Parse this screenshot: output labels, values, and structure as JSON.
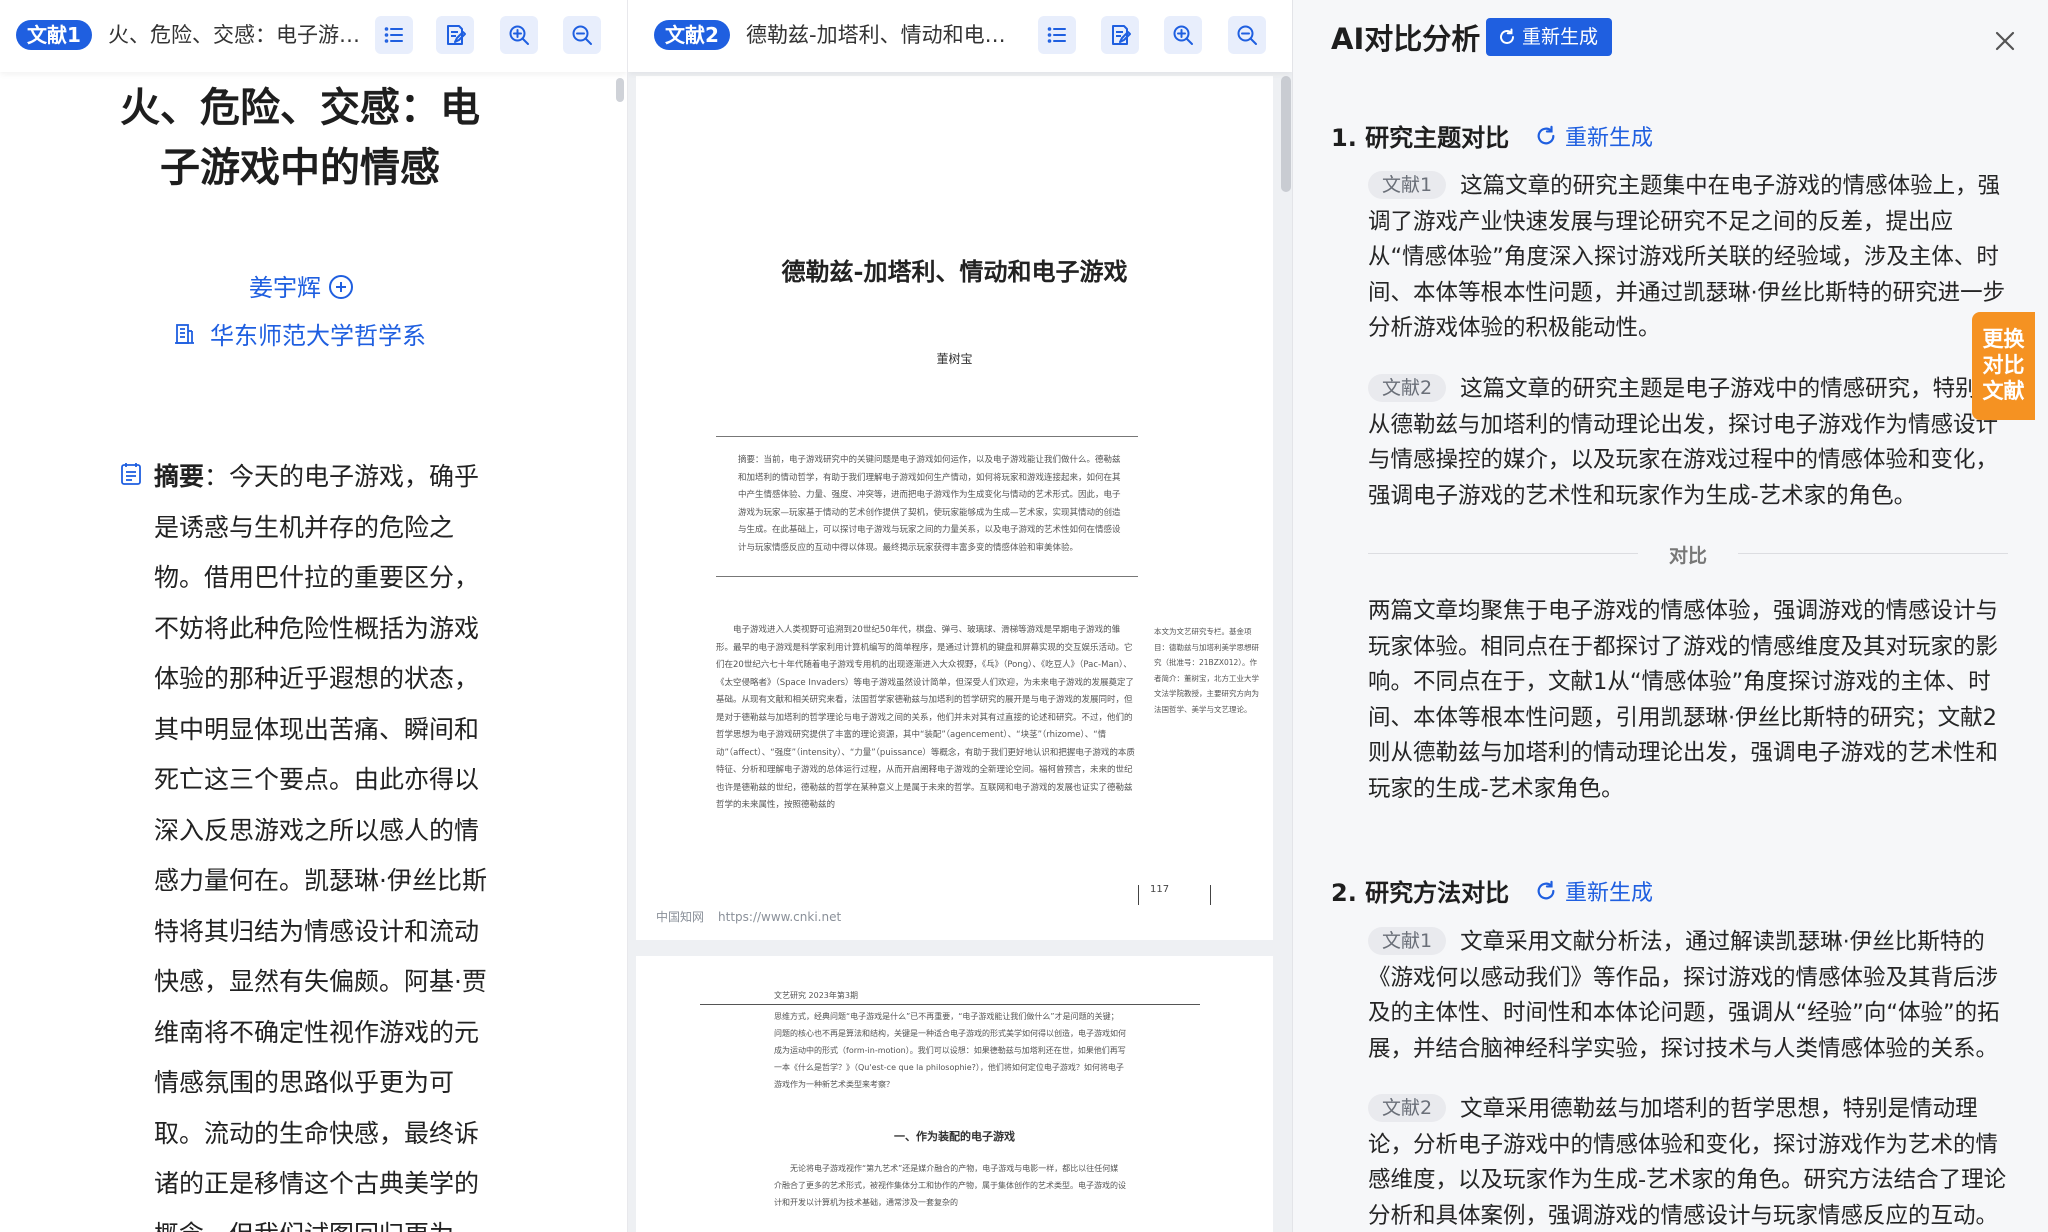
{
  "doc1": {
    "tag": "文献1",
    "toolbar_title": "火、危险、交感：电子游戏中的情感",
    "title": "火、危险、交感：电子游戏中的情感",
    "author": "姜宇辉",
    "affiliation": "华东师范大学哲学系",
    "abstract_label": "摘要",
    "abstract_text": "：今天的电子游戏，确乎是诱惑与生机并存的危险之物。借用巴什拉的重要区分，不妨将此种危险性概括为游戏体验的那种近乎遐想的状态，其中明显体现出苦痛、瞬间和死亡这三个要点。由此亦得以深入反思游戏之所以感人的情感力量何在。凯瑟琳·伊丝比斯特将其归结为情感设计和流动快感，显然有失偏颇。阿基·贾维南将不确定性视作游戏的元情感氛围的思路似乎更为可取。流动的生命快感，最终诉诸的正是移情这个古典美学的概念，但我们试图回归更为"
  },
  "doc2": {
    "tag": "文献2",
    "toolbar_title": "德勒兹-加塔利、情动和电子游戏",
    "title": "德勒兹-加塔利、情动和电子游戏",
    "author": "董树宝",
    "abstract": "摘要：当前，电子游戏研究中的关键问题是电子游戏如何运作，以及电子游戏能让我们做什么。德勒兹和加塔利的情动哲学，有助于我们理解电子游戏如何生产情动，如何将玩家和游戏连接起来，如何在其中产生情感体验、力量、强度、冲突等，进而把电子游戏作为生成变化与情动的艺术形式。因此，电子游戏为玩家—玩家基于情动的艺术创作提供了契机，使玩家能够成为生成—艺术家，实现其情动的创造与生成。在此基础上，可以探讨电子游戏与玩家之间的力量关系，以及电子游戏的艺术性如何在情感设计与玩家情感反应的互动中得以体现。最终揭示玩家获得丰富多变的情感体验和审美体验。",
    "body": "电子游戏进入人类视野可追溯到20世纪50年代，棋盘、弹弓、玻璃球、滑梯等游戏是早期电子游戏的雏形。最早的电子游戏是科学家利用计算机编写的简单程序，是通过计算机的键盘和屏幕实现的交互娱乐活动。它们在20世纪六七十年代随着电子游戏专用机的出现逐渐进入大众视野，《乓》（Pong）、《吃豆人》（Pac-Man）、《太空侵略者》（Space Invaders）等电子游戏虽然设计简单，但深受人们欢迎，为未来电子游戏的发展奠定了基础。从现有文献和相关研究来看，法国哲学家德勒兹与加塔利的哲学研究的展开是与电子游戏的发展同时，但是对于德勒兹与加塔利的哲学理论与电子游戏之间的关系，他们并未对其有过直接的论述和研究。不过，他们的哲学思想为电子游戏研究提供了丰富的理论资源，其中“装配”（agencement）、“块茎”（rhizome）、“情动”（affect）、“强度”（intensity）、“力量”（puissance）等概念，有助于我们更好地认识和把握电子游戏的本质特征、分析和理解电子游戏的总体运行过程，从而开启阐释电子游戏的全新理论空间。福柯曾预言，未来的世纪也许是德勒兹的世纪，德勒兹的哲学在某种意义上是属于未来的哲学。互联网和电子游戏的发展也证实了德勒兹哲学的未来属性，按照德勒兹的",
    "side_note": "本文为文艺研究专栏。基金项目：德勒兹与加塔利美学思想研究（批准号：21BZX012）。作者简介：董树宝，北方工业大学文法学院教授，主要研究方向为法国哲学、美学与文艺理论。",
    "page_number": "117",
    "footer_site": "中国知网",
    "footer_url": "https://www.cnki.net",
    "p2_header": "文艺研究 2023年第3期",
    "p2_text": "思维方式，经典问题“电子游戏是什么”已不再重要，“电子游戏能让我们做什么”才是问题的关键；问题的核心也不再是算法和结构，关键是一种适合电子游戏的形式美学如何得以创造，电子游戏如何成为运动中的形式（form-in-motion）。我们可以设想：如果德勒兹与加塔利还在世，如果他们再写一本《什么是哲学？》（Qu'est-ce que la philosophie?），他们将如何定位电子游戏？如何将电子游戏作为一种新艺术类型来考察？",
    "p2_section": "一、作为装配的电子游戏",
    "p2_text2": "无论将电子游戏视作“第九艺术”还是媒介融合的产物，电子游戏与电影一样，都比以往任何媒介融合了更多的艺术形式，被视作集体分工和协作的产物，属于集体创作的艺术类型。电子游戏的设计和开发以计算机为技术基础，通常涉及一套复杂的"
  },
  "ai": {
    "title": "AI对比分析",
    "regen_label": "重新生成",
    "float_tab": [
      "更换",
      "对比",
      "文献"
    ],
    "sections": [
      {
        "heading": "1. 研究主题对比",
        "regen": "重新生成",
        "chip1": "文献1",
        "text1": "这篇文章的研究主题集中在电子游戏的情感体验上，强调了游戏产业快速发展与理论研究不足之间的反差，提出应从“情感体验”角度深入探讨游戏所关联的经验域，涉及主体、时间、本体等根本性问题，并通过凯瑟琳·伊丝比斯特的研究进一步分析游戏体验的积极能动性。",
        "chip2": "文献2",
        "text2": "这篇文章的研究主题是电子游戏中的情感研究，特别是从德勒兹与加塔利的情动理论出发，探讨电子游戏作为情感设计与情感操控的媒介，以及玩家在游戏过程中的情感体验和变化，强调电子游戏的艺术性和玩家作为生成-艺术家的角色。",
        "compare_label": "对比",
        "compare_text": "两篇文章均聚焦于电子游戏的情感体验，强调游戏的情感设计与玩家体验。相同点在于都探讨了游戏的情感维度及其对玩家的影响。不同点在于，文献1从“情感体验”角度探讨游戏的主体、时间、本体等根本性问题，引用凯瑟琳·伊丝比斯特的研究；文献2则从德勒兹与加塔利的情动理论出发，强调电子游戏的艺术性和玩家的生成-艺术家角色。"
      },
      {
        "heading": "2. 研究方法对比",
        "regen": "重新生成",
        "chip1": "文献1",
        "text1": "文章采用文献分析法，通过解读凯瑟琳·伊丝比斯特的《游戏何以感动我们》等作品，探讨游戏的情感体验及其背后涉及的主体性、时间性和本体论问题，强调从“经验”向“体验”的拓展，并结合脑神经科学实验，探讨技术与人类情感体验的关系。",
        "chip2": "文献2",
        "text2": "文章采用德勒兹与加塔利的哲学思想，特别是情动理论，分析电子游戏中的情感体验和变化，探讨游戏作为艺术的情感维度，以及玩家作为生成-艺术家的角色。研究方法结合了理论分析和具体案例，强调游戏的情感设计与玩家情感反应的互动。"
      }
    ]
  },
  "colors": {
    "accent": "#1f5fe0",
    "tab_orange": "#f59222",
    "chip_bg": "#e9eaee"
  },
  "icons": [
    "list-icon",
    "note-icon",
    "zoom-in-icon",
    "zoom-out-icon",
    "refresh-icon",
    "close-icon",
    "plus-circle-icon",
    "building-icon",
    "abstract-icon"
  ]
}
